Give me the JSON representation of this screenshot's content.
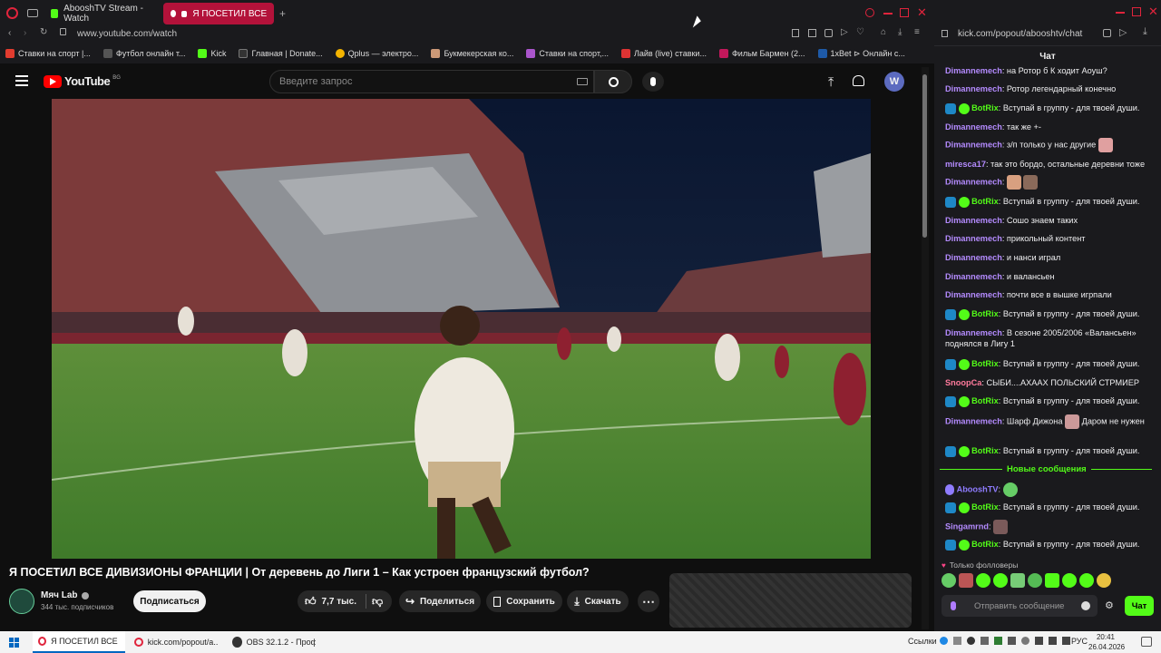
{
  "browser": {
    "tabs": [
      {
        "label": "AbooshTV Stream - Watch"
      },
      {
        "label": "Я ПОСЕТИЛ ВСЕ ДИВ"
      }
    ],
    "address": "www.youtube.com/watch",
    "bookmarks": [
      "Ставки на спорт |...",
      "Футбол онлайн т...",
      "Kick",
      "Главная | Donate...",
      "Qplus — электро...",
      "Букмекерская ко...",
      "Ставки на спорт,...",
      "Лайв (live) ставки...",
      "Фильм Бармен (2...",
      "1xBet ⊳ Онлайн с..."
    ],
    "colors": {
      "accent": "#b3123a",
      "kick_green": "#53fc18",
      "yt_red": "#ff0000"
    }
  },
  "youtube": {
    "logo": "YouTube",
    "region": "BG",
    "search_placeholder": "Введите запрос",
    "avatar_letter": "W",
    "video_title": "Я ПОСЕТИЛ ВСЕ ДИВИЗИОНЫ ФРАНЦИИ | От деревень до Лиги 1 – Как устроен французский футбол?",
    "channel": {
      "name": "Мяч Lab",
      "subs": "344 тыс. подписчиков",
      "subscribe": "Подписаться"
    },
    "actions": {
      "likes": "7,7 тыс.",
      "share": "Поделиться",
      "save": "Сохранить",
      "download": "Скачать"
    }
  },
  "chat": {
    "url": "kick.com/popout/abooshtv/chat",
    "header": "Чат",
    "messages": [
      {
        "user": "Dimannemech",
        "text": "на Ротор б К ходит Аоуш?",
        "color": "#b48bff"
      },
      {
        "user": "Dimannemech",
        "text": "Ротор легендарный конечно",
        "color": "#b48bff"
      },
      {
        "user": "BotRix",
        "text": "Вступай в группу - для твоей души.",
        "color": "#53fc18",
        "bot": true
      },
      {
        "user": "Dimannemech",
        "text": "так же +-",
        "color": "#b48bff"
      },
      {
        "user": "Dimannemech",
        "text": "з/п только у нас другие",
        "color": "#b48bff",
        "emote": true
      },
      {
        "user": "miresca17",
        "text": "так это бордо, остальные деревни тоже",
        "color": "#b48bff"
      },
      {
        "user": "Dimannemech",
        "text": "",
        "color": "#b48bff",
        "emote": true,
        "emote2": true
      },
      {
        "user": "BotRix",
        "text": "Вступай в группу - для твоей души.",
        "color": "#53fc18",
        "bot": true
      },
      {
        "user": "Dimannemech",
        "text": "Сошо знаем таких",
        "color": "#b48bff"
      },
      {
        "user": "Dimannemech",
        "text": "прикольный контент",
        "color": "#b48bff"
      },
      {
        "user": "Dimannemech",
        "text": "и нанси играл",
        "color": "#b48bff"
      },
      {
        "user": "Dimannemech",
        "text": "и валансьен",
        "color": "#b48bff"
      },
      {
        "user": "Dimannemech",
        "text": "почти все в вышке игрпали",
        "color": "#b48bff"
      },
      {
        "user": "BotRix",
        "text": "Вступай в группу - для твоей души.",
        "color": "#53fc18",
        "bot": true
      },
      {
        "user": "Dimannemech",
        "text": "В сезоне 2005/2006 «Валансьен»",
        "color": "#b48bff",
        "line2": "поднялся в Лигу 1"
      },
      {
        "user": "BotRix",
        "text": "Вступай в группу - для твоей души.",
        "color": "#53fc18",
        "bot": true
      },
      {
        "user": "SnoopCa",
        "text": "СЫБИ....АХААХ ПОЛЬСКИЙ СТРМИЕР",
        "color": "#ff7a9c"
      },
      {
        "user": "BotRix",
        "text": "Вступай в группу - для твоей души.",
        "color": "#53fc18",
        "bot": true
      },
      {
        "user": "Dimannemech",
        "text": "Шарф Дижона",
        "color": "#b48bff",
        "after": "Даром не нужен"
      },
      {
        "user": "BotRix",
        "text": "Вступай в группу - для твоей души.",
        "color": "#53fc18",
        "bot": true
      }
    ],
    "new_messages": "Новые сообщения",
    "after_new": [
      {
        "user": "AbooshTV",
        "text": "",
        "color": "#8f7cff",
        "emote": true
      },
      {
        "user": "BotRix",
        "text": "Вступай в группу - для твоей души.",
        "color": "#53fc18",
        "bot": true
      },
      {
        "user": "Singamrnd",
        "text": "",
        "color": "#b48bff",
        "emote": true
      },
      {
        "user": "BotRix",
        "text": "Вступай в группу - для твоей души.",
        "color": "#53fc18",
        "bot": true
      }
    ],
    "followers_only": "Только фолловеры",
    "input_placeholder": "Отправить сообщение",
    "send": "Чат"
  },
  "taskbar": {
    "items": [
      "Я ПОСЕТИЛ ВСЕ Д...",
      "kick.com/popout/a...",
      "OBS 32.1.2 - Проф..."
    ],
    "links": "Ссылки",
    "lang": "РУС",
    "time": "20:41",
    "date": "26.04.2026"
  }
}
